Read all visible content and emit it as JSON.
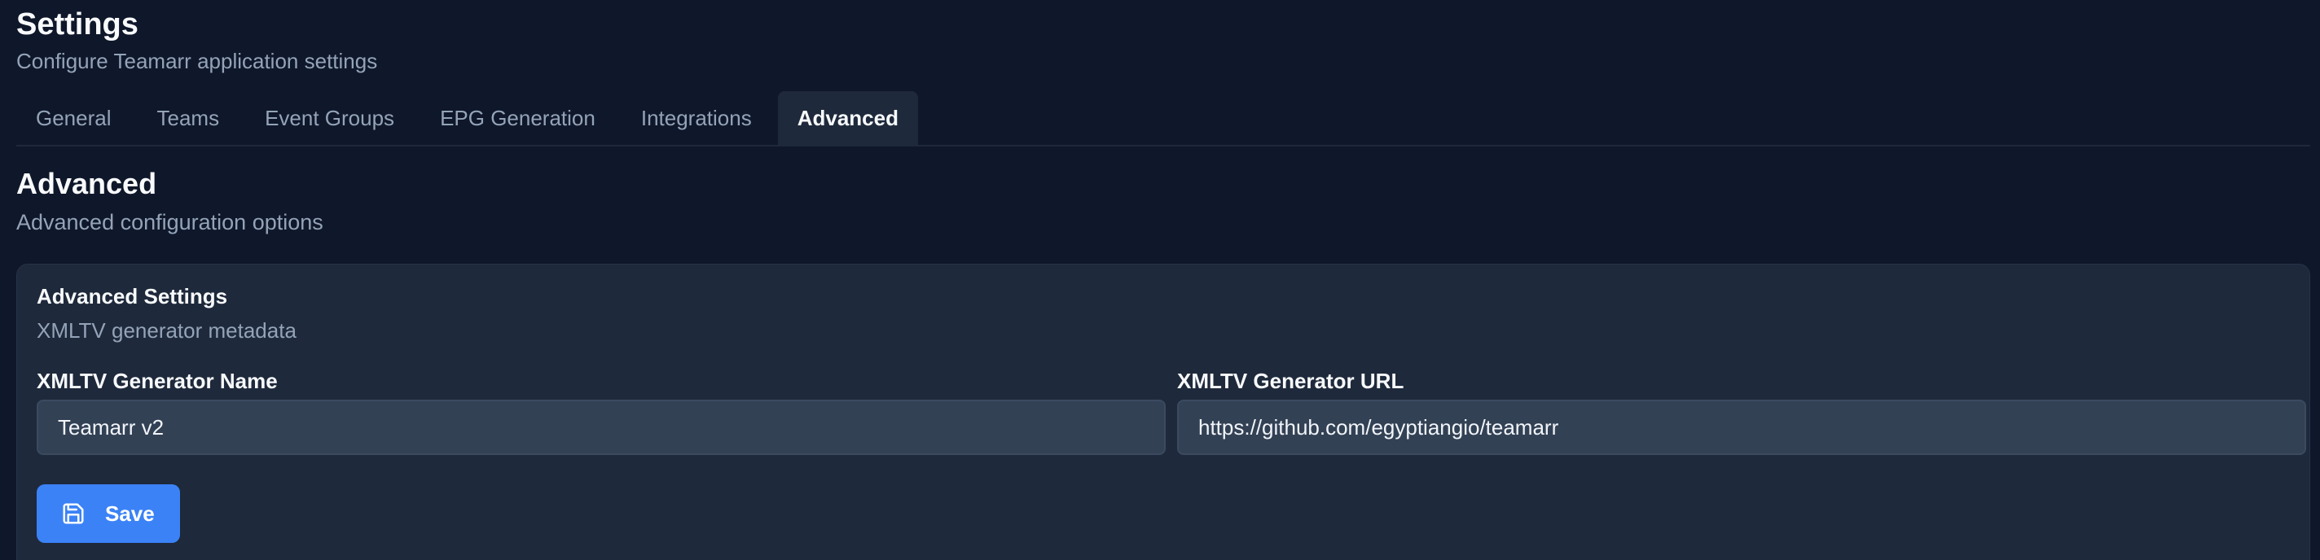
{
  "header": {
    "title": "Settings",
    "subtitle": "Configure Teamarr application settings"
  },
  "tabs": [
    {
      "label": "General",
      "active": false
    },
    {
      "label": "Teams",
      "active": false
    },
    {
      "label": "Event Groups",
      "active": false
    },
    {
      "label": "EPG Generation",
      "active": false
    },
    {
      "label": "Integrations",
      "active": false
    },
    {
      "label": "Advanced",
      "active": true
    }
  ],
  "section": {
    "title": "Advanced",
    "subtitle": "Advanced configuration options"
  },
  "card": {
    "title": "Advanced Settings",
    "description": "XMLTV generator metadata",
    "fields": {
      "generator_name": {
        "label": "XMLTV Generator Name",
        "value": "Teamarr v2"
      },
      "generator_url": {
        "label": "XMLTV Generator URL",
        "value": "https://github.com/egyptiangio/teamarr"
      }
    },
    "save_label": "Save",
    "save_icon": "save-icon"
  },
  "colors": {
    "background": "#0f172a",
    "card": "#1e293b",
    "input": "#334155",
    "accent": "#3b82f6",
    "muted_text": "#94a3b8"
  }
}
